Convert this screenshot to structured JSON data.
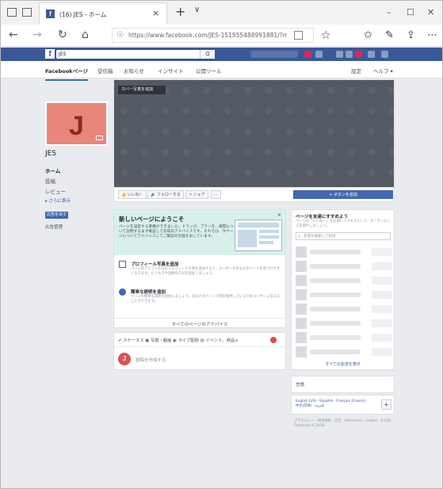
{
  "browser": {
    "tab_title": "(16) JES - ホーム",
    "close_tab": "×",
    "new_tab": "+",
    "tab_menu": "∨",
    "url": "https://www.facebook.com/JES-151555488991881/?modal=a",
    "win_min": "–",
    "win_max": "☐",
    "win_close": "✕",
    "back": "←",
    "forward": "→",
    "refresh": "↻",
    "home": "⌂",
    "lock": "🔒",
    "favorite": "☆",
    "favorites": "✩",
    "notes": "✎",
    "share": "⇪",
    "more": "⋯"
  },
  "fb": {
    "logo": "f",
    "search_value": "JES",
    "search_button": "Q"
  },
  "page_nav": {
    "items": [
      "Facebookページ",
      "受信箱",
      "お知らせ",
      "インサイト",
      "公開ツール"
    ],
    "right_items": [
      "設定",
      "ヘルプ ▾"
    ]
  },
  "page": {
    "name": "JES",
    "initial": "J",
    "left_nav": [
      "ホーム",
      "投稿",
      "レビュー"
    ],
    "more": "▸ さらに表示",
    "promote": "広告を出す",
    "ad_center": "広告管理",
    "add_cover": "カバー写真を追加"
  },
  "action_bar": {
    "like": "👍 いいね！",
    "follow": "🔊 フォローする",
    "share": "↗ シェア",
    "more": "···",
    "add_button": "+ ボタンを追加"
  },
  "welcome": {
    "title": "新しいページにようこそ",
    "description": "ページを設定する準備ができました。ドラッグ、プランを、期間について説明するまず確認して作成のアドバイスです、それでは、今ページについてアドバイスしてご確認の計画をおしています。",
    "tips": [
      {
        "title": "プロフィール写真を追加",
        "desc": "ページのアイコンとなるプロフィール写真を追加すると、ユーザーがあなたのページを見つけやすくなります。ビジネスや団体のロゴを追加しましょう。"
      },
      {
        "title": "簡単な説明を追加",
        "desc": "ページの簡単な説明を追加しましょう。あなたのページで何を提供しているかをユーザーに伝えることができます。"
      }
    ],
    "all_tips": "すべてのページのアドバイス"
  },
  "composer": {
    "tools": "✐ ステータス  ▣ 写真・動画  ◉ ライブ配信  ▤ イベント、商品+",
    "placeholder": "投稿を作成する"
  },
  "invite": {
    "title": "ページを友達にすすめよう",
    "desc": "ページの「いいね！」を友達にリクエストして、オーディエンスを増やしましょう。",
    "search_placeholder": "友達を検索して招待",
    "see_all": "すべての友達を表示"
  },
  "lang": {
    "title": "言語",
    "links": "English (US) · Español · Français (France) · 中文(简体) · العربية"
  },
  "footer": "プライバシー · 利用規約 · 広告 · AdChoices · Cookie · その他 · Facebook © 2018"
}
